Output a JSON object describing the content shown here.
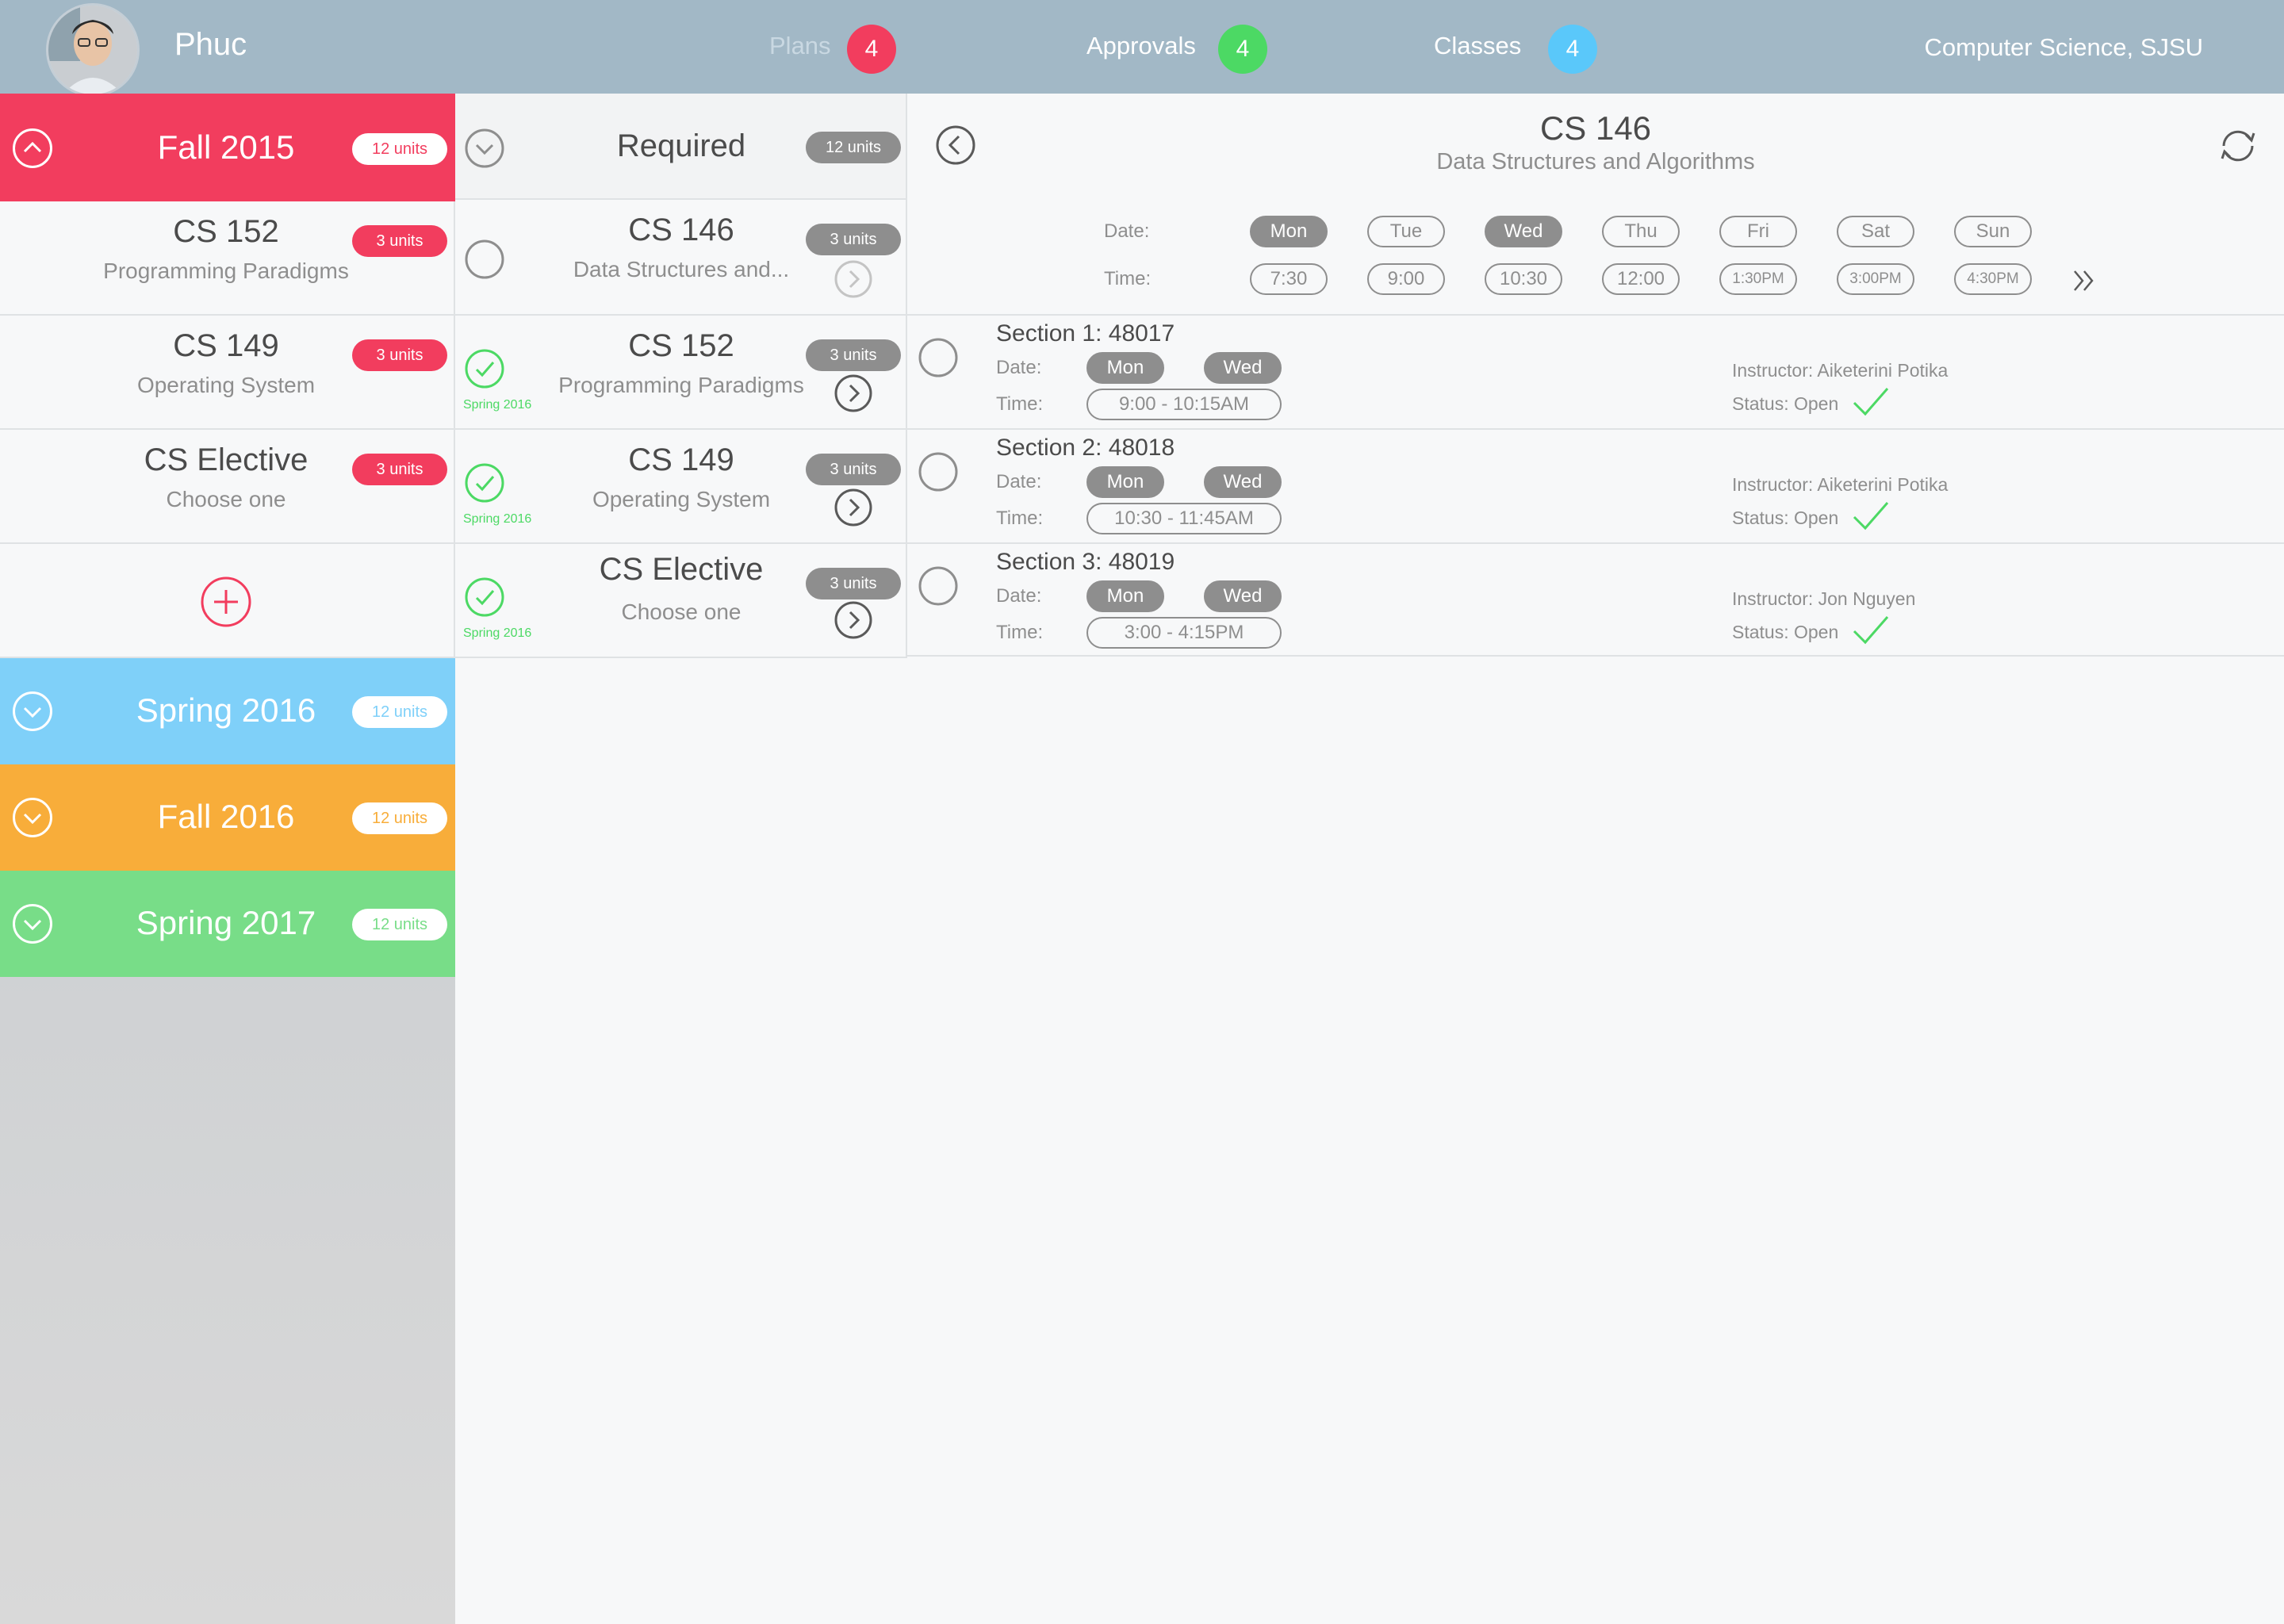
{
  "user": {
    "name": "Phuc"
  },
  "nav": {
    "plans": {
      "label": "Plans",
      "count": "4"
    },
    "approvals": {
      "label": "Approvals",
      "count": "4"
    },
    "classes": {
      "label": "Classes",
      "count": "4"
    },
    "org": "Computer Science, SJSU"
  },
  "colors": {
    "fall2015": "#f23d5e",
    "spring2016": "#7fd0f9",
    "fall2016": "#f8ad3a",
    "spring2017": "#78dd88",
    "badge_red": "#f23d5e",
    "badge_green": "#4cd964",
    "badge_blue": "#5ac8fa",
    "check_green": "#4cd964"
  },
  "terms": [
    {
      "title": "Fall 2015",
      "units": "12 units",
      "expanded": true
    },
    {
      "title": "Spring 2016",
      "units": "12 units",
      "expanded": false
    },
    {
      "title": "Fall 2016",
      "units": "12 units",
      "expanded": false
    },
    {
      "title": "Spring 2017",
      "units": "12 units",
      "expanded": false
    }
  ],
  "fall2015_courses": [
    {
      "code": "CS 152",
      "name": "Programming Paradigms",
      "units": "3 units"
    },
    {
      "code": "CS 149",
      "name": "Operating System",
      "units": "3 units"
    },
    {
      "code": "CS Elective",
      "name": "Choose one",
      "units": "3 units"
    }
  ],
  "required": {
    "title": "Required",
    "units": "12 units",
    "courses": [
      {
        "code": "CS 146",
        "name": "Data Structures and...",
        "units": "3 units",
        "done": false,
        "term": ""
      },
      {
        "code": "CS 152",
        "name": "Programming Paradigms",
        "units": "3 units",
        "done": true,
        "term": "Spring 2016"
      },
      {
        "code": "CS 149",
        "name": "Operating System",
        "units": "3 units",
        "done": true,
        "term": "Spring 2016"
      },
      {
        "code": "CS Elective",
        "name": "Choose one",
        "units": "3 units",
        "done": true,
        "term": "Spring 2016"
      }
    ]
  },
  "detail": {
    "code": "CS 146",
    "name": "Data Structures and Algorithms",
    "date_label": "Date:",
    "time_label": "Time:",
    "days": [
      {
        "label": "Mon",
        "on": true
      },
      {
        "label": "Tue",
        "on": false
      },
      {
        "label": "Wed",
        "on": true
      },
      {
        "label": "Thu",
        "on": false
      },
      {
        "label": "Fri",
        "on": false
      },
      {
        "label": "Sat",
        "on": false
      },
      {
        "label": "Sun",
        "on": false
      }
    ],
    "times": [
      "7:30",
      "9:00",
      "10:30",
      "12:00",
      "1:30PM",
      "3:00PM",
      "4:30PM"
    ],
    "sections": [
      {
        "title": "Section 1: 48017",
        "days": [
          "Mon",
          "Wed"
        ],
        "time": "9:00 - 10:15AM",
        "instructor": "Instructor: Aiketerini Potika",
        "status": "Status: Open"
      },
      {
        "title": "Section 2: 48018",
        "days": [
          "Mon",
          "Wed"
        ],
        "time": "10:30 - 11:45AM",
        "instructor": "Instructor: Aiketerini Potika",
        "status": "Status: Open"
      },
      {
        "title": "Section 3: 48019",
        "days": [
          "Mon",
          "Wed"
        ],
        "time": "3:00 - 4:15PM",
        "instructor": "Instructor: Jon Nguyen",
        "status": "Status: Open"
      }
    ]
  }
}
